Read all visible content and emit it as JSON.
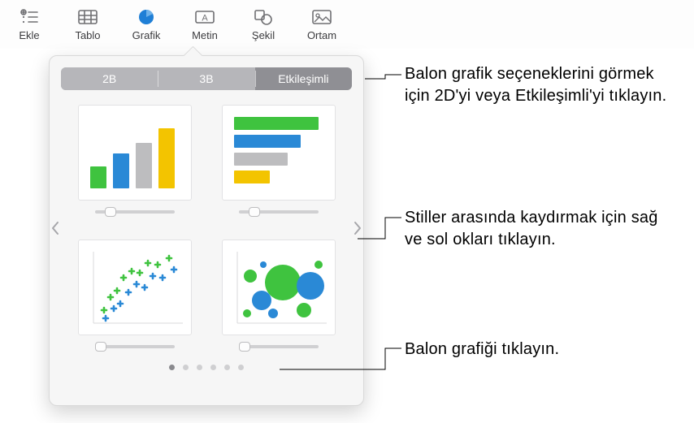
{
  "toolbar": {
    "items": [
      {
        "label": "Ekle",
        "name": "toolbar-insert"
      },
      {
        "label": "Tablo",
        "name": "toolbar-table"
      },
      {
        "label": "Grafik",
        "name": "toolbar-chart",
        "active": true
      },
      {
        "label": "Metin",
        "name": "toolbar-text"
      },
      {
        "label": "Şekil",
        "name": "toolbar-shape"
      },
      {
        "label": "Ortam",
        "name": "toolbar-media"
      }
    ]
  },
  "segmented": {
    "tabs": [
      {
        "label": "2B"
      },
      {
        "label": "3B"
      },
      {
        "label": "Etkileşimli",
        "active": true
      }
    ]
  },
  "pager": {
    "count": 6,
    "active": 0
  },
  "callouts": {
    "top": "Balon grafik seçeneklerini görmek için 2D'yi veya Etkileşimli'yi tıklayın.",
    "middle": "Stiller arasında kaydırmak için sağ ve sol okları tıklayın.",
    "bottom": "Balon grafiği tıklayın."
  },
  "colors": {
    "green": "#3fc33f",
    "blue": "#2a89d6",
    "gray": "#bdbdbf",
    "yellow": "#f3c400"
  }
}
